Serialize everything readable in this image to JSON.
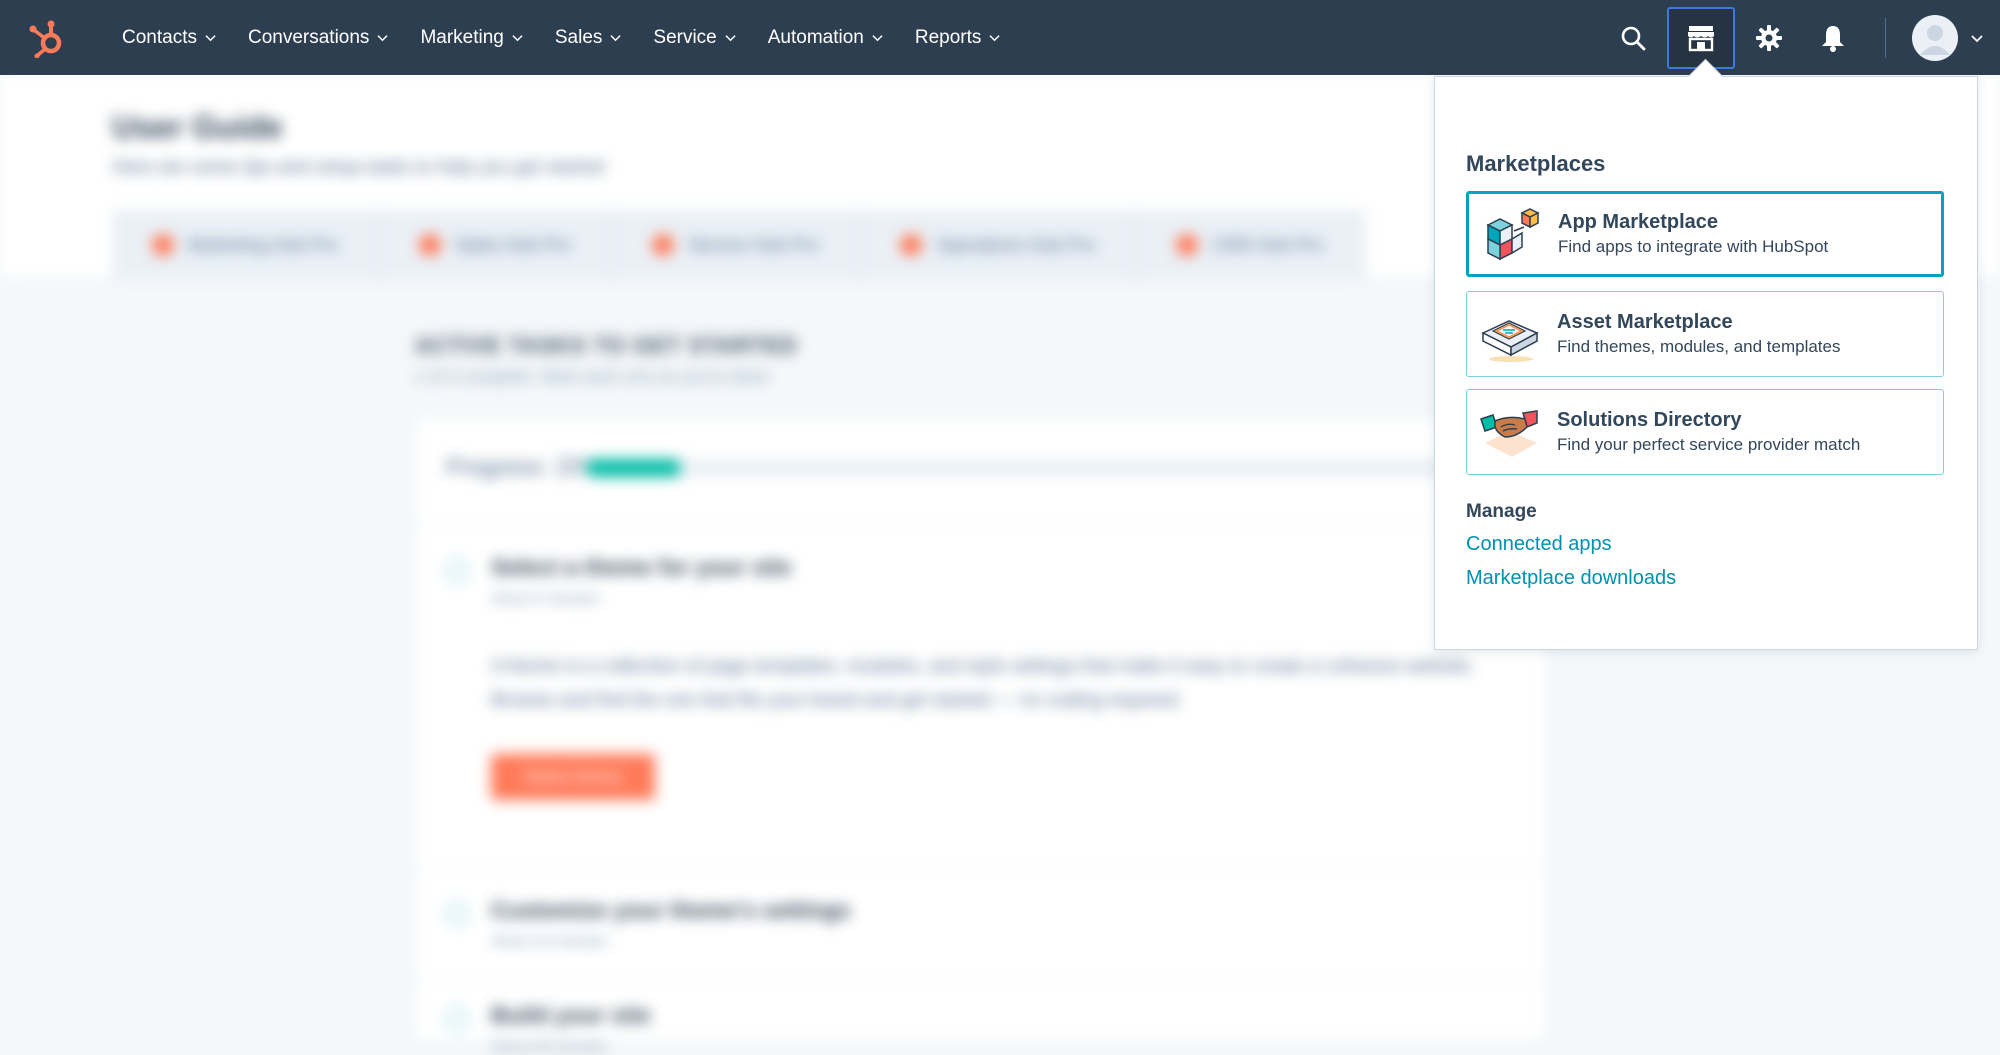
{
  "nav": {
    "items": [
      {
        "label": "Contacts"
      },
      {
        "label": "Conversations"
      },
      {
        "label": "Marketing"
      },
      {
        "label": "Sales"
      },
      {
        "label": "Service"
      },
      {
        "label": "Automation"
      },
      {
        "label": "Reports"
      }
    ],
    "icons": [
      "search-icon",
      "marketplace-icon",
      "settings-gear-icon",
      "notifications-bell-icon"
    ]
  },
  "background": {
    "title": "User Guide",
    "subtitle": "Here are some tips and setup tasks to help you get started",
    "tabs": [
      {
        "label": "Marketing Hub Pro"
      },
      {
        "label": "Sales Hub Pro"
      },
      {
        "label": "Service Hub Pro"
      },
      {
        "label": "Operations Hub Pro"
      },
      {
        "label": "CMS Hub Pro"
      }
    ],
    "section_title": "ACTIVE TASKS TO GET STARTED",
    "section_sub": "1 of 4 complete. Mark each one as you're done",
    "progress_label": "Progress: 25%",
    "progress_value": 0.1,
    "tasks": [
      {
        "title": "Select a theme for your site",
        "meta": "About 5 minutes",
        "body": "A theme is a collection of page templates, modules, and style settings that make it easy to create a cohesive website. Browse and find the one that fits your brand and get started — no coding required.",
        "button": "Select theme"
      },
      {
        "title": "Customize your theme's settings",
        "meta": "About 10 minutes"
      },
      {
        "title": "Build your site",
        "meta": "About 30 minutes"
      }
    ]
  },
  "dropdown": {
    "heading": "Marketplaces",
    "cards": [
      {
        "title": "App Marketplace",
        "desc": "Find apps to integrate with HubSpot"
      },
      {
        "title": "Asset Marketplace",
        "desc": "Find themes, modules, and templates"
      },
      {
        "title": "Solutions Directory",
        "desc": "Find your perfect service provider match"
      }
    ],
    "manage_heading": "Manage",
    "links": [
      {
        "label": "Connected apps"
      },
      {
        "label": "Marketplace downloads"
      }
    ]
  },
  "colors": {
    "nav_bg": "#2d3e50",
    "brand_orange": "#ff7a59",
    "link_teal": "#0091ae",
    "card_border": "#7fd1de",
    "selected_border": "#00a4bd"
  }
}
